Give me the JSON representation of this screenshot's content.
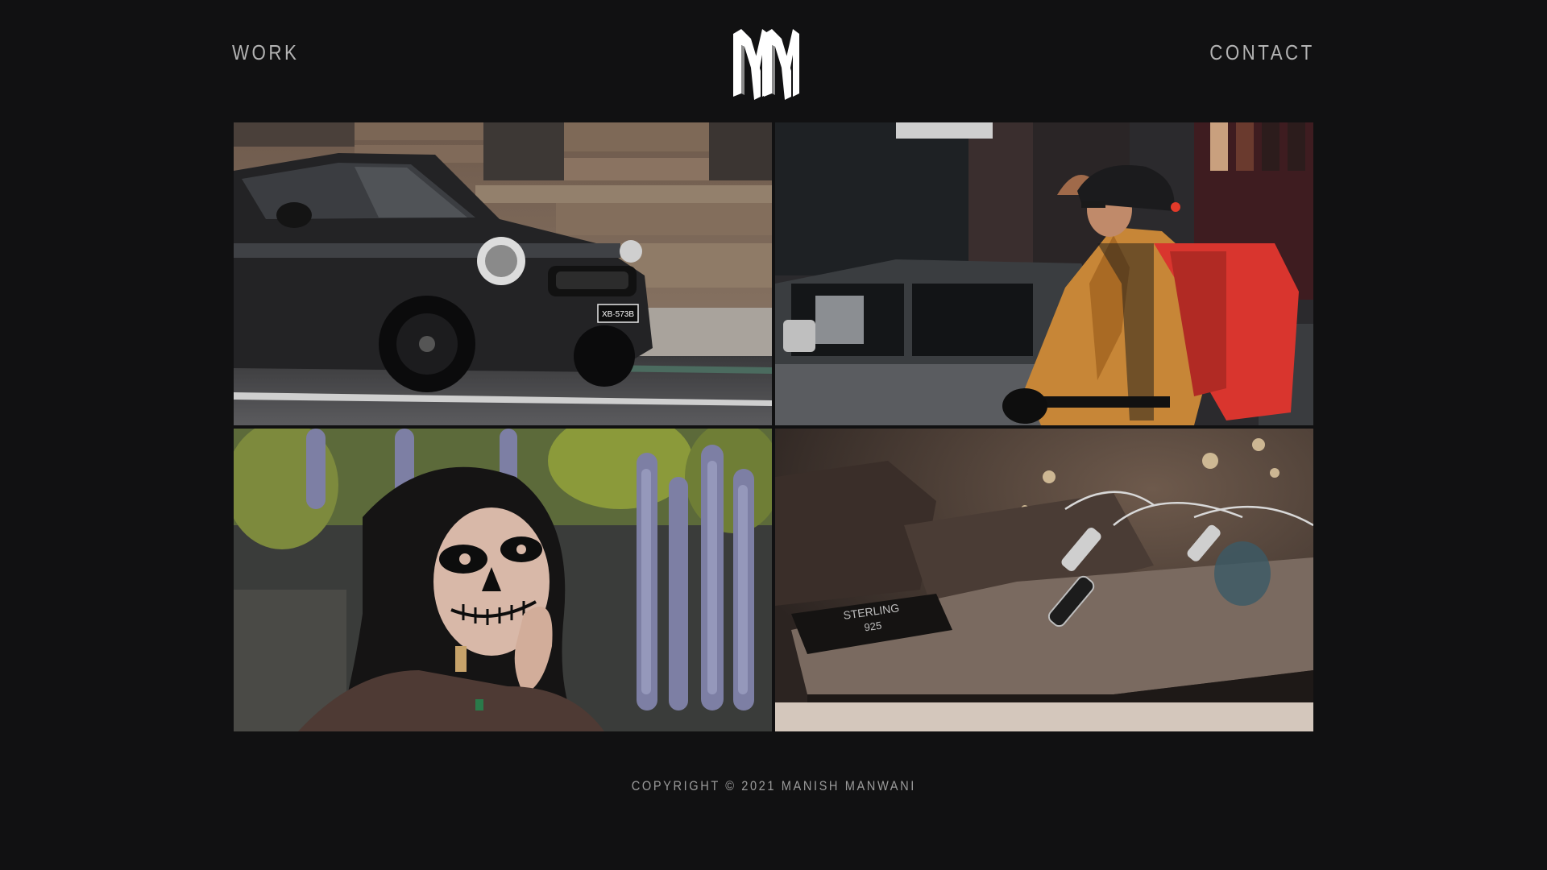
{
  "nav": {
    "work_label": "WORK",
    "contact_label": "CONTACT"
  },
  "logo": {
    "letters": "MM",
    "icon": "mm-monogram-logo"
  },
  "gallery": {
    "tiles": [
      {
        "subject": "car",
        "plate_text": "XB·573B"
      },
      {
        "subject": "cyclist"
      },
      {
        "subject": "portrait"
      },
      {
        "subject": "jewelry",
        "sign_text_line1": "STERLING",
        "sign_text_line2": "925"
      }
    ]
  },
  "footer": {
    "copyright": "COPYRIGHT © 2021 MANISH MANWANI"
  },
  "colors": {
    "background": "#111112",
    "nav_text": "#b3b3b3",
    "footer_text": "#9a9a9a"
  }
}
